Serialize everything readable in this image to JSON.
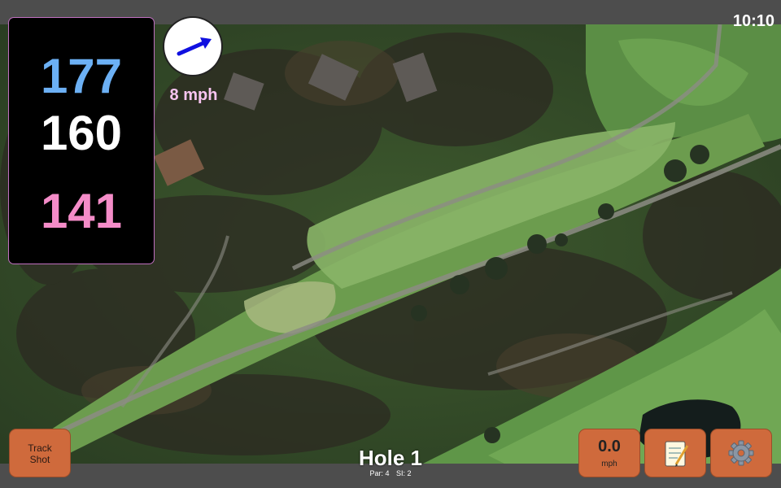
{
  "clock": "10:10",
  "yardages": {
    "back": "177",
    "center": "160",
    "front": "141"
  },
  "wind": {
    "speed": "8 mph",
    "icon": "wind-direction-arrow-icon"
  },
  "buttons": {
    "track_shot": [
      "Track",
      "Shot"
    ],
    "speed": {
      "value": "0.0",
      "unit": "mph"
    },
    "notes_icon": "notepad-icon",
    "settings_icon": "gear-icon"
  },
  "hole": {
    "title": "Hole 1",
    "par": "Par: 4",
    "si": "SI: 2"
  },
  "colors": {
    "back_yardage": "#6cb0f4",
    "center_yardage": "#ffffff",
    "front_yardage": "#f48cc8",
    "button": "#cf6a3c",
    "wind_text": "#f7c4f0"
  }
}
